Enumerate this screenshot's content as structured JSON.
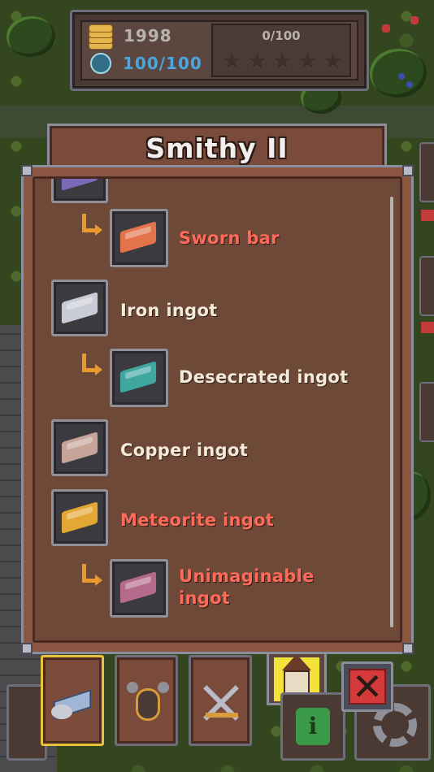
{
  "hud": {
    "gold": "1998",
    "souls": "100/100",
    "progress": "0/100",
    "star_count": 5,
    "stars_filled": 0
  },
  "window": {
    "title": "Smithy II"
  },
  "items": [
    {
      "name": "Sworn bar",
      "color": "red",
      "sub": true,
      "icon": "sworn-bar-icon",
      "ingot_color": "#e2734a"
    },
    {
      "name": "Iron ingot",
      "color": "cream",
      "sub": false,
      "icon": "iron-ingot-icon",
      "ingot_color": "#c9ccd6"
    },
    {
      "name": "Desecrated ingot",
      "color": "cream",
      "sub": true,
      "icon": "desecrated-ingot-icon",
      "ingot_color": "#3fa6a0"
    },
    {
      "name": "Copper ingot",
      "color": "cream",
      "sub": false,
      "icon": "copper-ingot-icon",
      "ingot_color": "#c7a39a"
    },
    {
      "name": "Meteorite ingot",
      "color": "red",
      "sub": false,
      "icon": "meteorite-ingot-icon",
      "ingot_color": "#e2a833"
    },
    {
      "name": "Unimaginable ingot",
      "color": "red",
      "sub": true,
      "icon": "unimaginable-ingot-icon",
      "ingot_color": "#b46a8a"
    }
  ],
  "colors": {
    "red_label": "#ff6a5a",
    "cream_label": "#f4ead9",
    "panel": "#8b5742",
    "active_tab": "#e8c23a"
  },
  "bottom_tabs": [
    {
      "icon": "ingots-tab-icon",
      "active": true
    },
    {
      "icon": "armor-tab-icon",
      "active": false
    },
    {
      "icon": "swords-tab-icon",
      "active": false
    }
  ]
}
